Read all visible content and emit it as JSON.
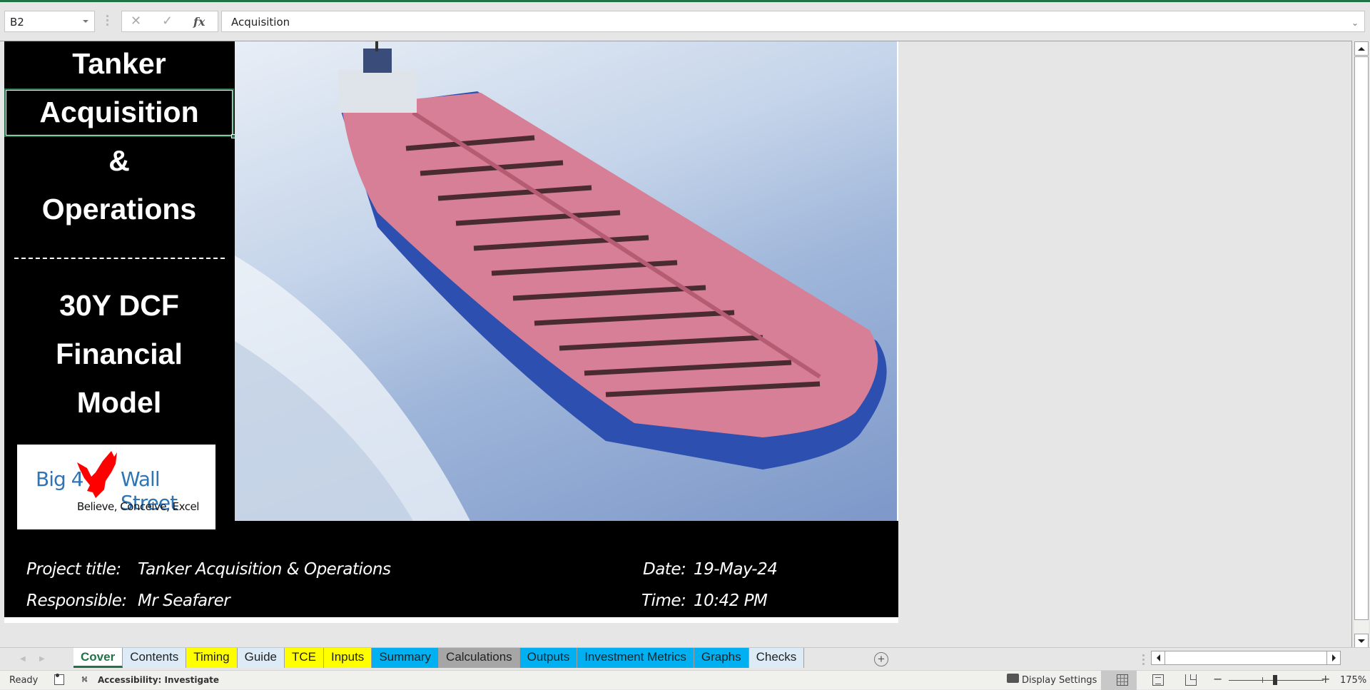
{
  "formula_bar": {
    "name_box": "B2",
    "cancel_icon": "✕",
    "enter_icon": "✓",
    "fx_label": "fx",
    "formula_value": "Acquisition",
    "expand_icon": "⌄"
  },
  "cover": {
    "title_lines": [
      "Tanker",
      "Acquisition",
      "&",
      "Operations"
    ],
    "subtitle_lines": [
      "30Y DCF",
      "Financial",
      "Model"
    ],
    "logo": {
      "left_text": "Big 4",
      "right_text": "Wall Street",
      "tagline": "Believe, Conceive, Excel"
    },
    "photo_alt": "Oil tanker ship at sea",
    "project_title_label": "Project title:",
    "project_title_value": "Tanker Acquisition & Operations",
    "responsible_label": "Responsible:",
    "responsible_value": "Mr Seafarer",
    "date_label": "Date:",
    "date_value": "19-May-24",
    "time_label": "Time:",
    "time_value": "10:42 PM"
  },
  "sheet_tabs": [
    {
      "label": "Cover",
      "color": "#ffffff",
      "active": true
    },
    {
      "label": "Contents",
      "color": "#ddebf7"
    },
    {
      "label": "Timing",
      "color": "#ffff00"
    },
    {
      "label": "Guide",
      "color": "#ddebf7"
    },
    {
      "label": "TCE",
      "color": "#ffff00"
    },
    {
      "label": "Inputs",
      "color": "#ffff00"
    },
    {
      "label": "Summary",
      "color": "#00b0f0"
    },
    {
      "label": "Calculations",
      "color": "#a6a6a6"
    },
    {
      "label": "Outputs",
      "color": "#00b0f0"
    },
    {
      "label": "Investment Metrics",
      "color": "#00b0f0"
    },
    {
      "label": "Graphs",
      "color": "#00b0f0"
    },
    {
      "label": "Checks",
      "color": "#ddebf7"
    }
  ],
  "tab_nav": {
    "prev": "◀",
    "next": "▶",
    "add": "+"
  },
  "status_bar": {
    "ready": "Ready",
    "accessibility": "Accessibility: Investigate",
    "display_settings": "Display Settings",
    "zoom_minus": "−",
    "zoom_plus": "+",
    "zoom_percent": "175%",
    "zoom_level": 1.75
  },
  "colors": {
    "excel_green": "#217346",
    "cover_background": "#000000",
    "cover_text": "#ffffff",
    "logo_blue": "#2e75b6",
    "logo_red": "#ff0000"
  }
}
